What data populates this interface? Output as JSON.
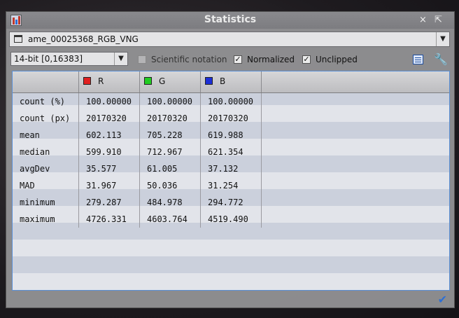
{
  "window": {
    "title": "Statistics",
    "pin_glyph": "×",
    "minimize_glyph": "⇱"
  },
  "view_select": {
    "value": "ame_00025368_RGB_VNG",
    "arrow_glyph": "▼"
  },
  "bit_select": {
    "value": "14-bit [0,16383]",
    "arrow_glyph": "▼"
  },
  "options": {
    "scientific_notation": {
      "label": "Scientific notation",
      "checked": false
    },
    "normalized": {
      "label": "Normalized",
      "checked": true
    },
    "unclipped": {
      "label": "Unclipped",
      "checked": true
    }
  },
  "icons": {
    "table_icon": "spreadsheet-icon",
    "settings_icon": "wrench-icon",
    "ok_icon": "checkmark-icon"
  },
  "colors": {
    "R": "#e02020",
    "G": "#22cc22",
    "B": "#1c2fd6",
    "accent": "#5a8fd6"
  },
  "table": {
    "columns": [
      {
        "name": "R",
        "color": "#e02020"
      },
      {
        "name": "G",
        "color": "#22cc22"
      },
      {
        "name": "B",
        "color": "#1c2fd6"
      }
    ],
    "rows": [
      {
        "label": "count (%)",
        "values": [
          "100.00000",
          "100.00000",
          "100.00000"
        ]
      },
      {
        "label": "count (px)",
        "values": [
          "20170320",
          "20170320",
          "20170320"
        ]
      },
      {
        "label": "mean",
        "values": [
          "602.113",
          "705.228",
          "619.988"
        ]
      },
      {
        "label": "median",
        "values": [
          "599.910",
          "712.967",
          "621.354"
        ]
      },
      {
        "label": "avgDev",
        "values": [
          "35.577",
          "61.005",
          "37.132"
        ]
      },
      {
        "label": "MAD",
        "values": [
          "31.967",
          "50.036",
          "31.254"
        ]
      },
      {
        "label": "minimum",
        "values": [
          "279.287",
          "484.978",
          "294.772"
        ]
      },
      {
        "label": "maximum",
        "values": [
          "4726.331",
          "4603.764",
          "4519.490"
        ]
      }
    ]
  }
}
